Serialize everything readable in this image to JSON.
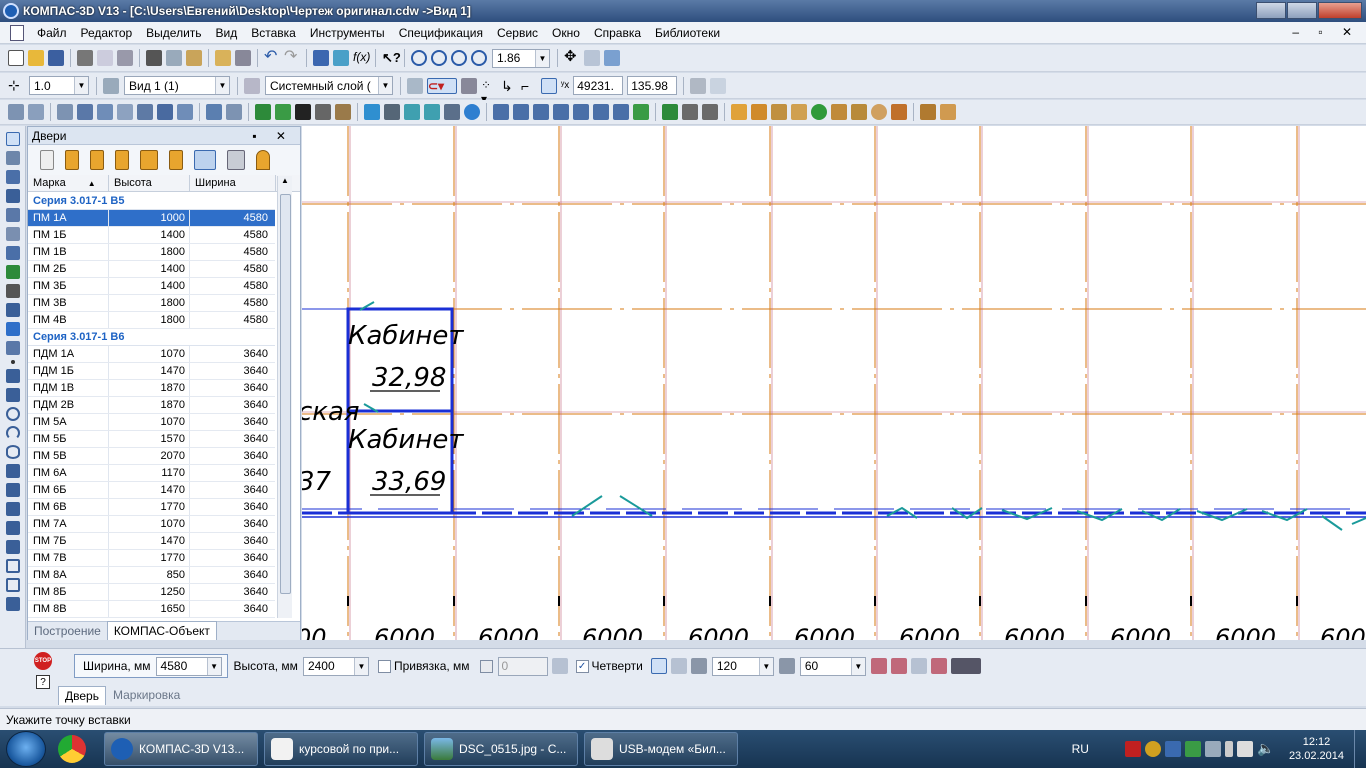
{
  "window": {
    "title": "КОМПАС-3D V13 - [C:\\Users\\Евгений\\Desktop\\Чертеж оригинал.cdw ->Вид 1]"
  },
  "menu": [
    "Файл",
    "Редактор",
    "Выделить",
    "Вид",
    "Вставка",
    "Инструменты",
    "Спецификация",
    "Сервис",
    "Окно",
    "Справка",
    "Библиотеки"
  ],
  "toolbar1": {
    "zoom": "1.86"
  },
  "toolbar2": {
    "step": "1.0",
    "view": "Вид 1 (1)",
    "layer": "Системный слой (",
    "coord_x": "49231.",
    "coord_y": "135.98"
  },
  "panel": {
    "title": "Двери",
    "columns": [
      "Марка",
      "Высота",
      "Ширина"
    ],
    "groups": [
      {
        "name": "Серия 3.017-1 В5",
        "rows": [
          [
            "ПМ 1А",
            "1000",
            "4580"
          ],
          [
            "ПМ 1Б",
            "1400",
            "4580"
          ],
          [
            "ПМ 1В",
            "1800",
            "4580"
          ],
          [
            "ПМ 2Б",
            "1400",
            "4580"
          ],
          [
            "ПМ 3Б",
            "1400",
            "4580"
          ],
          [
            "ПМ 3В",
            "1800",
            "4580"
          ],
          [
            "ПМ 4В",
            "1800",
            "4580"
          ]
        ]
      },
      {
        "name": "Серия 3.017-1 В6",
        "rows": [
          [
            "ПДМ 1А",
            "1070",
            "3640"
          ],
          [
            "ПДМ 1Б",
            "1470",
            "3640"
          ],
          [
            "ПДМ 1В",
            "1870",
            "3640"
          ],
          [
            "ПДМ 2В",
            "1870",
            "3640"
          ],
          [
            "ПМ 5А",
            "1070",
            "3640"
          ],
          [
            "ПМ 5Б",
            "1570",
            "3640"
          ],
          [
            "ПМ 5В",
            "2070",
            "3640"
          ],
          [
            "ПМ 6А",
            "1170",
            "3640"
          ],
          [
            "ПМ 6Б",
            "1470",
            "3640"
          ],
          [
            "ПМ 6В",
            "1770",
            "3640"
          ],
          [
            "ПМ 7А",
            "1070",
            "3640"
          ],
          [
            "ПМ 7Б",
            "1470",
            "3640"
          ],
          [
            "ПМ 7В",
            "1770",
            "3640"
          ],
          [
            "ПМ 8А",
            "850",
            "3640"
          ],
          [
            "ПМ 8Б",
            "1250",
            "3640"
          ],
          [
            "ПМ 8В",
            "1650",
            "3640"
          ]
        ]
      }
    ],
    "selected": "ПМ 1А",
    "tabs": [
      "Построение",
      "КОМПАС-Объект"
    ]
  },
  "drawing": {
    "rooms": [
      {
        "name": "Кабинет",
        "area": "32,98"
      },
      {
        "name": "Кабинет",
        "area": "33,69"
      }
    ],
    "fragments": [
      "ская",
      "37"
    ],
    "dimensions": [
      "00",
      "6000",
      "6000",
      "6000",
      "6000",
      "6000",
      "6000",
      "6000",
      "6000",
      "6000",
      "600"
    ]
  },
  "properties": {
    "width_label": "Ширина, мм",
    "width_value": "4580",
    "height_label": "Высота, мм",
    "height_value": "2400",
    "snap_label": "Привязка, мм",
    "snap_value": "0",
    "quarters_label": "Четверти",
    "value_a": "120",
    "value_b": "60",
    "tabs": [
      "Дверь",
      "Маркировка"
    ],
    "stop_text": "STOP"
  },
  "status": "Укажите точку вставки",
  "taskbar": {
    "apps": [
      "КОМПАС-3D V13...",
      "курсовой по при...",
      "DSC_0515.jpg - С...",
      "USB-модем «Бил..."
    ],
    "lang": "RU",
    "time": "12:12",
    "date": "23.02.2014"
  }
}
